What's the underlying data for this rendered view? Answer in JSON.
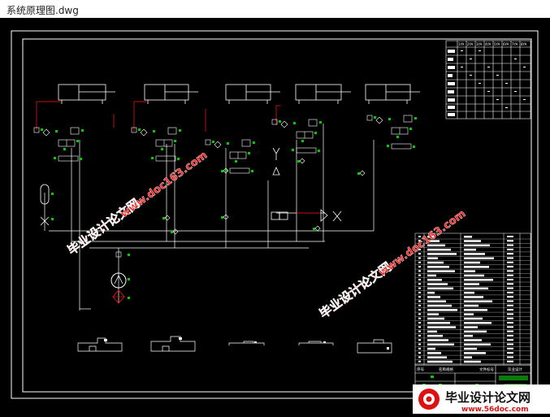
{
  "window": {
    "title": "系统原理图.dwg"
  },
  "colors": {
    "background": "#000000",
    "lines": "#ffffff",
    "pipes_red": "#cc1111",
    "components_green": "#00cc00",
    "watermark": "#ff2020",
    "logo_red": "#dd1111"
  },
  "table": {
    "header_numbers": [
      "1YA",
      "2YA",
      "3YA",
      "4YA",
      "5YA",
      "6YA",
      "7YA",
      "8YA"
    ]
  },
  "title_block": {
    "labels": [
      "序号",
      "名称规格",
      "文件标号",
      "毕业设计"
    ]
  },
  "watermarks": {
    "site_name": "毕业设计论文网",
    "site_url": "www.doc163.com",
    "logo_text": "毕业设计论文网",
    "logo_url": "www.56doc.com"
  },
  "icons": [
    "valve-icon",
    "pump-icon",
    "cylinder-icon",
    "logo-icon"
  ]
}
